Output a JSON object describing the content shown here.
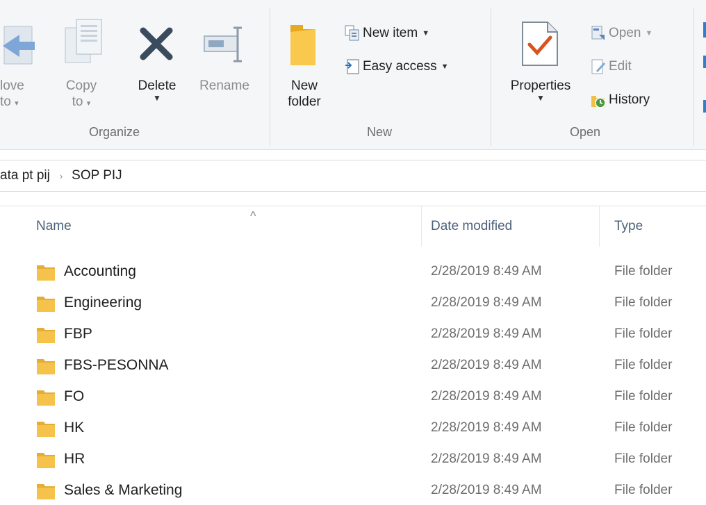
{
  "ribbon": {
    "clipboard_partial": {
      "move_to": {
        "line1": "love",
        "line2": "to"
      }
    },
    "organize": {
      "group_label": "Organize",
      "copy_to": {
        "line1": "Copy",
        "line2": "to"
      },
      "delete": {
        "label": "Delete"
      },
      "rename": {
        "label": "Rename"
      }
    },
    "new": {
      "group_label": "New",
      "new_folder": {
        "line1": "New",
        "line2": "folder"
      },
      "new_item": "New item",
      "easy_access": "Easy access"
    },
    "open": {
      "group_label": "Open",
      "properties": "Properties",
      "open": "Open",
      "edit": "Edit",
      "history": "History"
    }
  },
  "address": {
    "crumbs": [
      "ata pt pij",
      "SOP PIJ"
    ],
    "separator": "›"
  },
  "columns": {
    "name": "Name",
    "date_modified": "Date modified",
    "type": "Type",
    "sort_indicator": "^"
  },
  "files": [
    {
      "name": "Accounting",
      "date": "2/28/2019 8:49 AM",
      "type": "File folder"
    },
    {
      "name": "Engineering",
      "date": "2/28/2019 8:49 AM",
      "type": "File folder"
    },
    {
      "name": "FBP",
      "date": "2/28/2019 8:49 AM",
      "type": "File folder"
    },
    {
      "name": "FBS-PESONNA",
      "date": "2/28/2019 8:49 AM",
      "type": "File folder"
    },
    {
      "name": "FO",
      "date": "2/28/2019 8:49 AM",
      "type": "File folder"
    },
    {
      "name": "HK",
      "date": "2/28/2019 8:49 AM",
      "type": "File folder"
    },
    {
      "name": "HR",
      "date": "2/28/2019 8:49 AM",
      "type": "File folder"
    },
    {
      "name": "Sales & Marketing",
      "date": "2/28/2019 8:49 AM",
      "type": "File folder"
    }
  ],
  "icons": {
    "move_to": "move-to-icon",
    "copy_to": "copy-to-icon",
    "delete": "delete-x-icon",
    "rename": "rename-icon",
    "new_folder": "new-folder-icon",
    "new_item": "new-item-icon",
    "easy_access": "easy-access-icon",
    "properties": "properties-check-icon",
    "open": "open-icon",
    "edit": "edit-icon",
    "history": "history-icon",
    "folder": "folder-icon"
  },
  "colors": {
    "delete_x": "#3b4b5e",
    "folder_yellow": "#f5c34b",
    "header_text": "#4c607a",
    "check_red": "#d9531e"
  }
}
